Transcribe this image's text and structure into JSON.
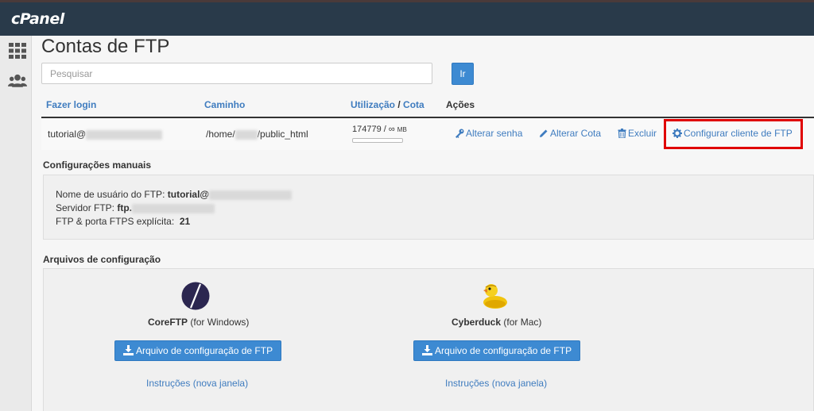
{
  "topbar": {
    "logo": "cPanel"
  },
  "page": {
    "title": "Contas de FTP"
  },
  "search": {
    "placeholder": "Pesquisar",
    "button": "Ir"
  },
  "table": {
    "col_login": "Fazer login",
    "col_path": "Caminho",
    "col_usage": "Utilização",
    "col_sep": "/",
    "col_quota": "Cota",
    "col_actions": "Ações",
    "row": {
      "login_prefix": "tutorial@",
      "path_prefix": "/home/",
      "path_suffix": "/public_html",
      "usage": "174779 / ∞",
      "usage_unit": "MB",
      "usage_fraction": 0
    },
    "actions": {
      "change_password": "Alterar senha",
      "change_quota": "Alterar Cota",
      "delete": "Excluir",
      "configure_client": "Configurar cliente de FTP"
    }
  },
  "manual": {
    "heading": "Configurações manuais",
    "user_label": "Nome de usuário do FTP:",
    "user_value": "tutorial@",
    "server_label": "Servidor FTP:",
    "server_value": "ftp.",
    "port_label": "FTP & porta FTPS explícita:",
    "port_value": "21"
  },
  "config_files": {
    "heading": "Arquivos de configuração",
    "clients": [
      {
        "name": "CoreFTP",
        "platform": "(for Windows)",
        "download": "Arquivo de configuração de FTP",
        "instructions": "Instruções (nova janela)",
        "icon": "coreftp-logo-icon"
      },
      {
        "name": "Cyberduck",
        "platform": "(for Mac)",
        "download": "Arquivo de configuração de FTP",
        "instructions": "Instruções (nova janela)",
        "icon": "cyberduck-logo-icon"
      }
    ]
  },
  "colors": {
    "link": "#3f7cbf",
    "button": "#3d8ad2",
    "highlight": "#e00000",
    "topbar": "#293a4a"
  }
}
